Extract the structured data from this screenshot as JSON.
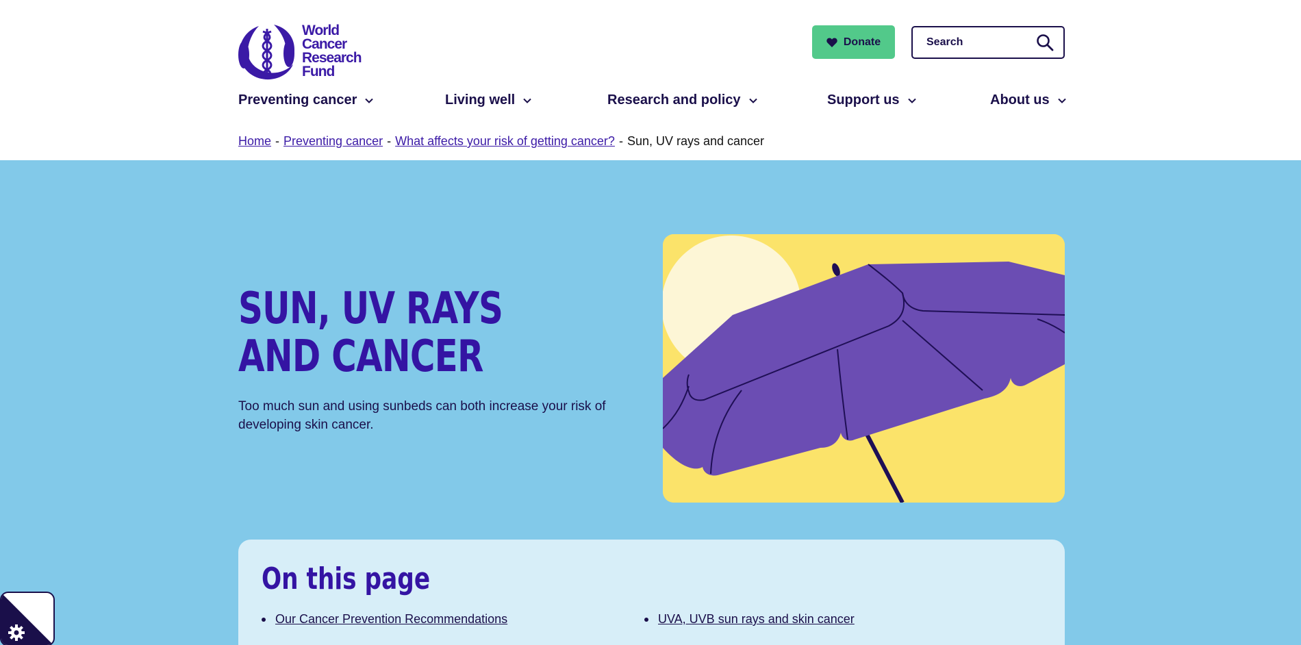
{
  "logo": {
    "text_lines": [
      "World",
      "Cancer",
      "Research",
      "Fund"
    ]
  },
  "header": {
    "donate_label": "Donate",
    "search_placeholder": "Search"
  },
  "nav": {
    "items": [
      {
        "label": "Preventing cancer"
      },
      {
        "label": "Living well"
      },
      {
        "label": "Research and policy"
      },
      {
        "label": "Support us"
      },
      {
        "label": "About us"
      }
    ]
  },
  "breadcrumb": {
    "links": [
      "Home",
      "Preventing cancer",
      "What affects your risk of getting cancer?"
    ],
    "current": "Sun, UV rays and cancer",
    "separator": "-"
  },
  "hero": {
    "title": "Sun, UV rays and cancer",
    "intro": "Too much sun and using sunbeds can both increase your risk of developing skin cancer."
  },
  "toc": {
    "title": "On this page",
    "items": [
      {
        "label": "Our Cancer Prevention Recommendations"
      },
      {
        "label": "UVA, UVB sun rays and skin cancer"
      }
    ]
  },
  "colors": {
    "brand_purple": "#3414a3",
    "navy": "#1a0f4a",
    "hero_bg": "#82c9e9",
    "toc_bg": "#d7eef8",
    "donate_green": "#52c98a",
    "image_yellow": "#fbe36a",
    "umbrella_purple": "#6b4db3"
  },
  "icons": {
    "logo": "caduceus-logo-icon",
    "donate": "heart-icon",
    "search": "search-icon",
    "nav_chevron": "chevron-down-icon",
    "cookie": "cookie-settings-icon"
  }
}
